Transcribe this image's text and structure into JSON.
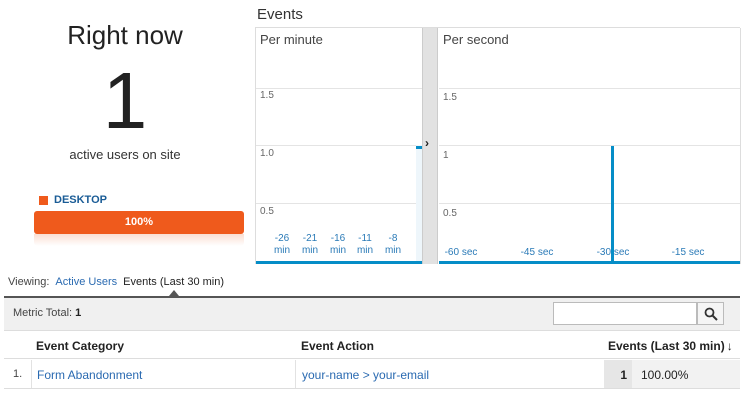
{
  "realtime": {
    "title": "Right now",
    "active_users": "1",
    "caption": "active users on site",
    "device": {
      "label": "DESKTOP",
      "percent_text": "100%",
      "share": 1.0,
      "color": "#ef5a1c"
    }
  },
  "events_panel": {
    "title": "Events",
    "per_minute": {
      "heading": "Per minute",
      "y_labels": [
        "1.5",
        "1.0",
        "0.5"
      ],
      "x_labels": [
        {
          "value": "-26",
          "unit": "min"
        },
        {
          "value": "-21",
          "unit": "min"
        },
        {
          "value": "-16",
          "unit": "min"
        },
        {
          "value": "-11",
          "unit": "min"
        },
        {
          "value": "-8",
          "unit": "min"
        }
      ]
    },
    "per_second": {
      "heading": "Per second",
      "y_labels": [
        "1.5",
        "1",
        "0.5"
      ],
      "x_labels": [
        "-60 sec",
        "-45 sec",
        "-30 sec",
        "-15 sec"
      ]
    },
    "bar_color": "#058dc7"
  },
  "chart_data": [
    {
      "type": "bar",
      "title": "Per minute",
      "x": [
        -1
      ],
      "values": [
        1
      ],
      "ylim": [
        0,
        1.5
      ]
    },
    {
      "type": "bar",
      "title": "Per second",
      "x": [
        -30
      ],
      "values": [
        1
      ],
      "ylim": [
        0,
        1.5
      ]
    }
  ],
  "viewing": {
    "label": "Viewing:",
    "tabs": [
      "Active Users",
      "Events (Last 30 min)"
    ],
    "active_tab": "Events (Last 30 min)"
  },
  "table": {
    "metric_total_label": "Metric Total:",
    "metric_total_value": "1",
    "search_placeholder": "",
    "columns": [
      "Event Category",
      "Event Action",
      "Events (Last 30 min)"
    ],
    "sort_indicator": "↓",
    "rows": [
      {
        "index": "1.",
        "category": "Form Abandonment",
        "action": "your-name > your-email",
        "events": "1",
        "percent": "100.00%"
      }
    ]
  }
}
